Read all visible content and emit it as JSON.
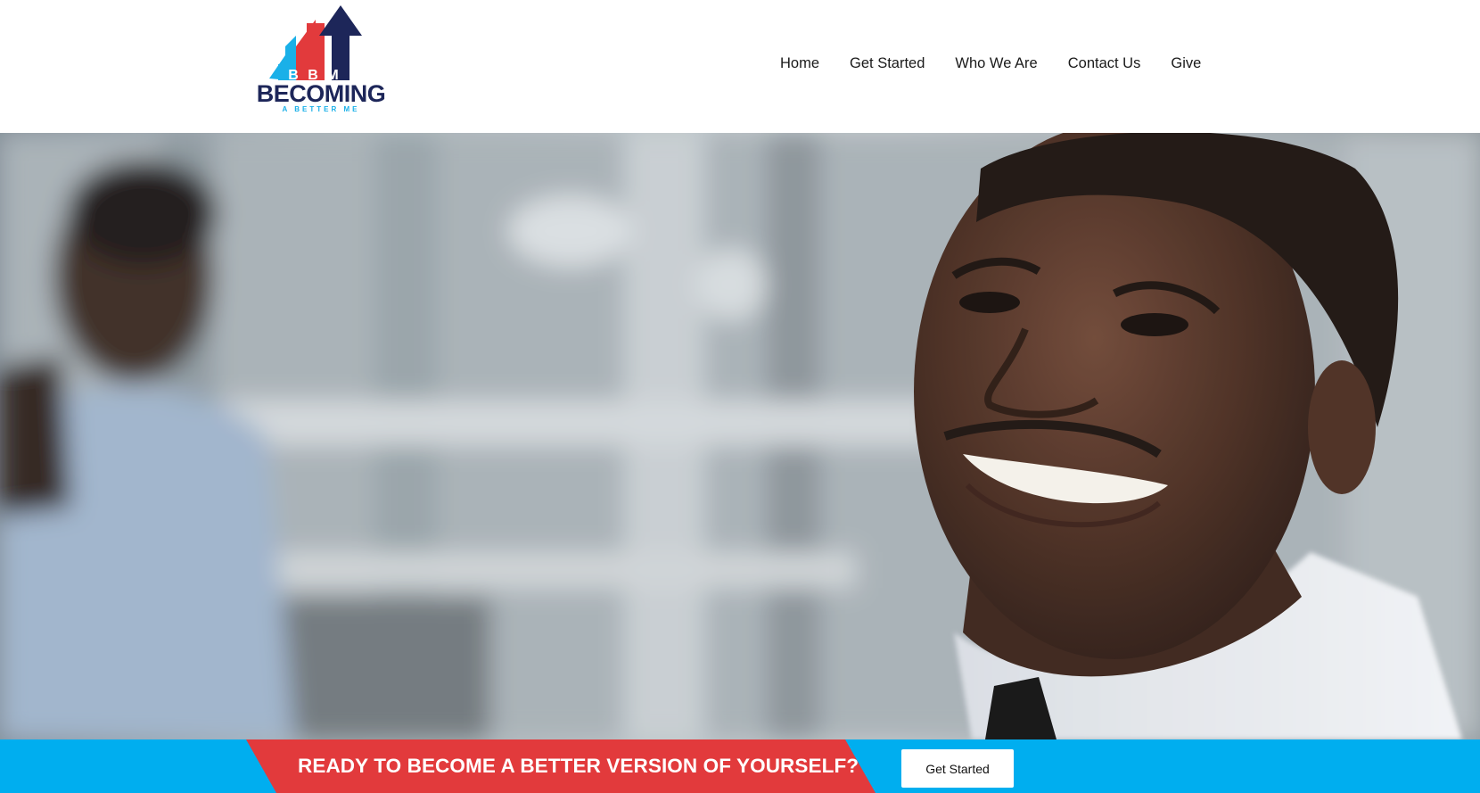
{
  "brand": {
    "logo_word": "BECOMING",
    "logo_tagline": "A BETTER ME",
    "logo_letters": [
      "B",
      "B",
      "M"
    ],
    "colors": {
      "navy": "#1d2659",
      "red": "#e23a3c",
      "blue": "#1ab0e8"
    }
  },
  "nav": {
    "items": [
      {
        "label": "Home"
      },
      {
        "label": "Get Started"
      },
      {
        "label": "Who We Are"
      },
      {
        "label": "Contact Us"
      },
      {
        "label": "Give"
      }
    ]
  },
  "hero": {
    "image_subject": "smiling-man-photo"
  },
  "cta": {
    "headline": "READY TO BECOME A BETTER VERSION OF YOURSELF?",
    "button_label": "Get Started",
    "colors": {
      "band": "#00aeef",
      "headline_bg": "#e23a3c"
    }
  }
}
